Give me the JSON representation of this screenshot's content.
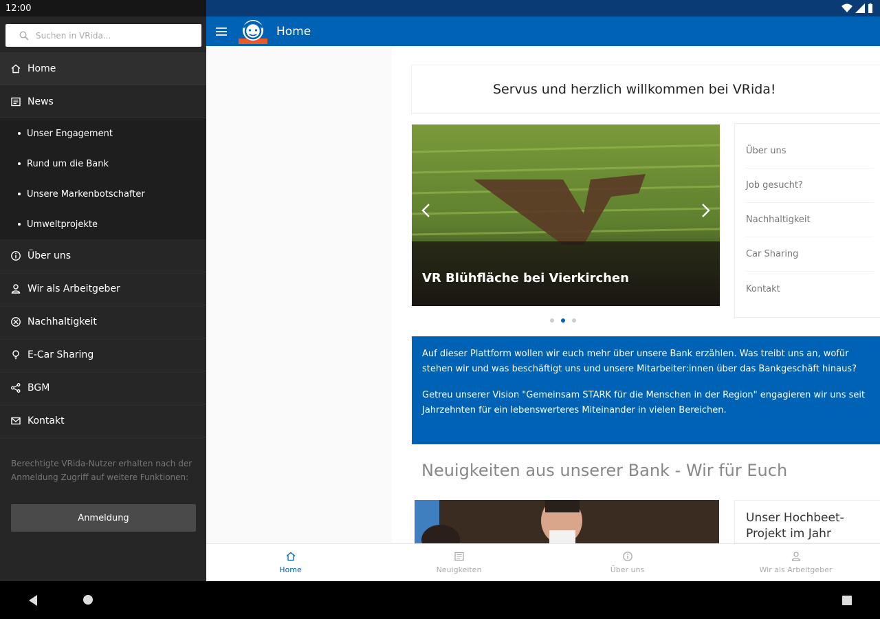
{
  "status": {
    "time": "12:00"
  },
  "search": {
    "placeholder": "Suchen in VRida..."
  },
  "nav": {
    "items": [
      {
        "label": "Home",
        "icon": "home-icon"
      },
      {
        "label": "News",
        "icon": "newspaper-icon"
      }
    ],
    "news_sub": [
      {
        "label": "Unser Engagement"
      },
      {
        "label": "Rund um die Bank"
      },
      {
        "label": "Unsere Markenbotschafter"
      },
      {
        "label": "Umweltprojekte"
      }
    ],
    "more": [
      {
        "label": "Über uns",
        "icon": "info-icon"
      },
      {
        "label": "Wir als Arbeitgeber",
        "icon": "person-icon"
      },
      {
        "label": "Nachhaltigkeit",
        "icon": "sustainability-icon"
      },
      {
        "label": "E-Car Sharing",
        "icon": "lightbulb-icon"
      },
      {
        "label": "BGM",
        "icon": "share-icon"
      },
      {
        "label": "Kontakt",
        "icon": "mail-icon"
      }
    ]
  },
  "drawer": {
    "note": "Berechtigte VRida-Nutzer erhalten nach der Anmeldung Zugriff auf weitere Funktionen:",
    "login_label": "Anmeldung"
  },
  "header": {
    "title": "Home"
  },
  "welcome": "Servus und herzlich willkommen bei VRida!",
  "carousel": {
    "caption": "VR Blühfläche bei Vierkirchen",
    "active_index": 1,
    "count": 3
  },
  "quick_links": [
    {
      "label": "Über uns"
    },
    {
      "label": "Job gesucht?"
    },
    {
      "label": "Nachhaltigkeit"
    },
    {
      "label": "Car Sharing"
    },
    {
      "label": "Kontakt"
    }
  ],
  "info": {
    "p1": "Auf dieser Plattform wollen wir euch mehr über unsere Bank erzählen. Was treibt uns an, wofür stehen wir und was beschäftigt uns und unsere Mitarbeiter:innen über das Bankgeschäft hinaus?",
    "p2": "Getreu unserer Vision \"Gemeinsam STARK für die Menschen in der Region\" engagieren wir uns seit Jahrzehnten für ein lebenswerteres Miteinander in vielen Bereichen."
  },
  "news_heading": "Neuigkeiten aus unserer Bank - Wir für Euch",
  "news_card_title": "Unser Hochbeet-Projekt im Jahr",
  "bottom_nav": [
    {
      "label": "Home",
      "icon": "home-icon"
    },
    {
      "label": "Neuigkeiten",
      "icon": "newspaper-icon"
    },
    {
      "label": "Über uns",
      "icon": "info-icon"
    },
    {
      "label": "Wir als Arbeitgeber",
      "icon": "person-icon"
    }
  ],
  "colors": {
    "brand_blue": "#0062b4",
    "status_dark_blue": "#0b3b74",
    "drawer_bg": "#262626"
  }
}
